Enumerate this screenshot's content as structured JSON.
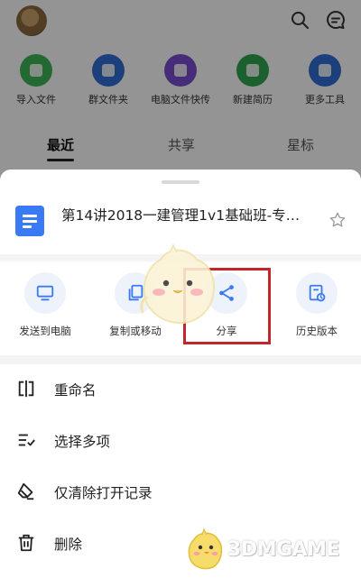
{
  "background": {
    "quick_tools": [
      {
        "label": "导入文件",
        "icon": "wechat-icon",
        "color": "#3cb556"
      },
      {
        "label": "群文件夹",
        "icon": "group-folder-icon",
        "color": "#2f6fd6"
      },
      {
        "label": "电脑文件快传",
        "icon": "pc-transfer-icon",
        "color": "#7b4fd0"
      },
      {
        "label": "新建简历",
        "icon": "resume-icon",
        "color": "#2fa84f"
      },
      {
        "label": "更多工具",
        "icon": "more-tools-icon",
        "color": "#2f6fd6"
      }
    ],
    "tabs": [
      {
        "label": "最近",
        "active": true
      },
      {
        "label": "共享",
        "active": false
      },
      {
        "label": "星标",
        "active": false
      }
    ]
  },
  "sheet": {
    "file_name": "第14讲2018一建管理1v1基础班-专…",
    "file_icon_color": "#3a7af5",
    "actions": [
      {
        "label": "发送到电脑",
        "icon": "monitor-icon"
      },
      {
        "label": "复制或移动",
        "icon": "copy-move-icon"
      },
      {
        "label": "分享",
        "icon": "share-icon"
      },
      {
        "label": "历史版本",
        "icon": "history-version-icon"
      }
    ],
    "highlight_color": "#c0272d",
    "menu": [
      {
        "label": "重命名",
        "icon": "rename-icon"
      },
      {
        "label": "选择多项",
        "icon": "multi-select-icon"
      },
      {
        "label": "仅清除打开记录",
        "icon": "eraser-icon"
      },
      {
        "label": "删除",
        "icon": "trash-icon"
      }
    ]
  },
  "watermark": {
    "text": "3DMGAME"
  }
}
